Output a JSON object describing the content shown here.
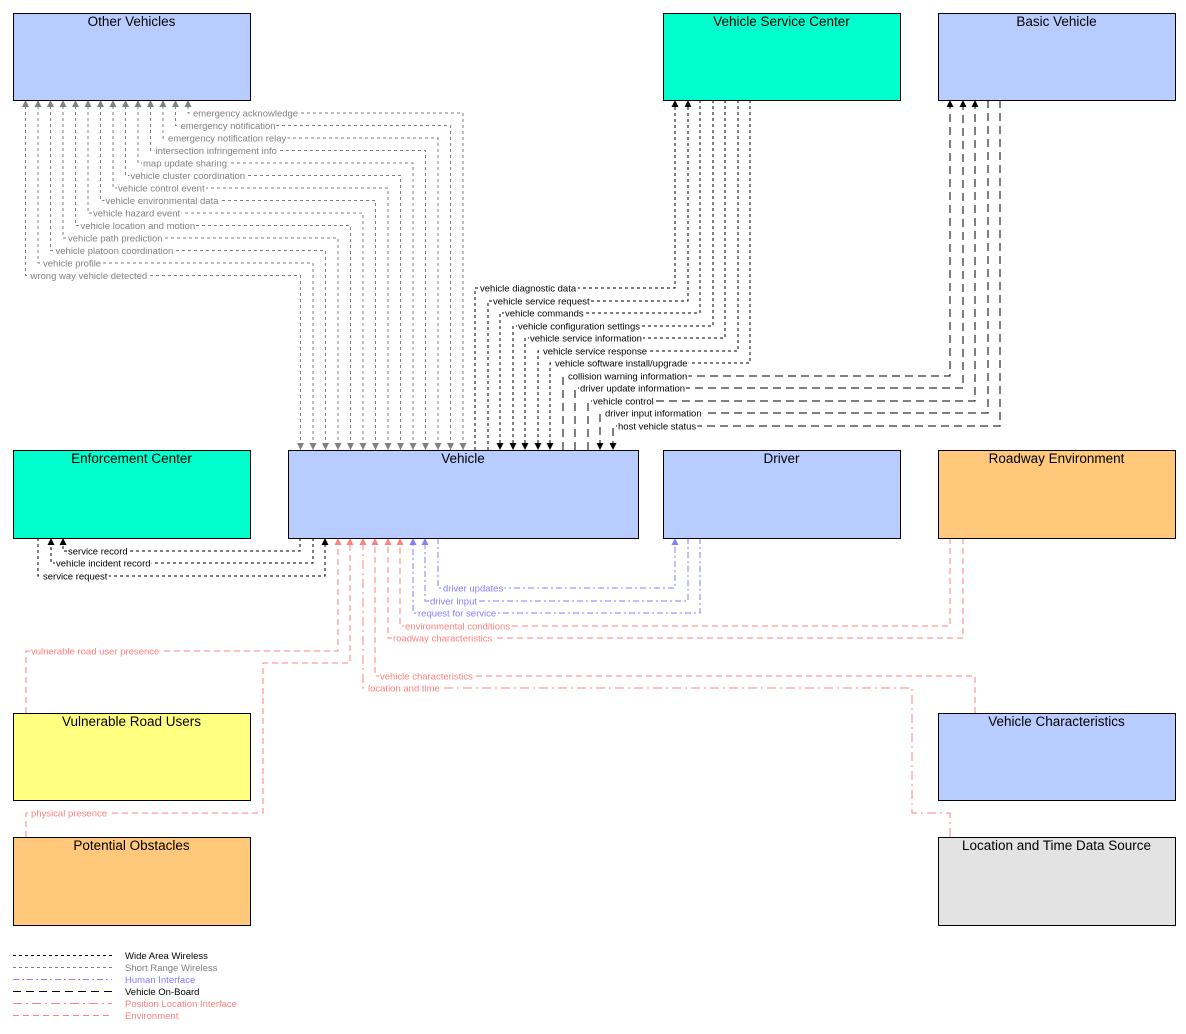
{
  "colors": {
    "wide_area_wireless": "#000000",
    "short_range_wireless": "#808080",
    "human_interface": "#8080ff",
    "vehicle_on_board": "#000000",
    "position_location_interface": "#ff8080",
    "environment": "#ff8080",
    "box_blue": "#b8ccff",
    "box_teal": "#00ffcc",
    "box_yellow": "#ffff80",
    "box_orange": "#ffc87a",
    "box_gray": "#e3e3e3"
  },
  "boxes": [
    {
      "id": "other-vehicles",
      "title": "Other Vehicles",
      "fill": "box_blue"
    },
    {
      "id": "vehicle-service-center",
      "title": "Vehicle Service Center",
      "fill": "box_teal"
    },
    {
      "id": "basic-vehicle",
      "title": "Basic Vehicle",
      "fill": "box_blue"
    },
    {
      "id": "enforcement-center",
      "title": "Enforcement Center",
      "fill": "box_teal"
    },
    {
      "id": "vehicle",
      "title": "Vehicle",
      "fill": "box_blue"
    },
    {
      "id": "driver",
      "title": "Driver",
      "fill": "box_blue"
    },
    {
      "id": "roadway-environment",
      "title": "Roadway Environment",
      "fill": "box_orange"
    },
    {
      "id": "vulnerable-road-users",
      "title": "Vulnerable Road Users",
      "fill": "box_yellow"
    },
    {
      "id": "vehicle-characteristics",
      "title": "Vehicle Characteristics",
      "fill": "box_blue"
    },
    {
      "id": "potential-obstacles",
      "title": "Potential Obstacles",
      "fill": "box_orange"
    },
    {
      "id": "location-and-time-data-source",
      "title": "Location and Time Data Source",
      "fill": "box_gray"
    }
  ],
  "flows": [
    {
      "label": "emergency acknowledge",
      "type": "short_range_wireless",
      "between": [
        "Other Vehicles",
        "Vehicle"
      ],
      "bidirectional": true
    },
    {
      "label": "emergency notification",
      "type": "short_range_wireless",
      "between": [
        "Other Vehicles",
        "Vehicle"
      ],
      "bidirectional": true
    },
    {
      "label": "emergency notification relay",
      "type": "short_range_wireless",
      "between": [
        "Other Vehicles",
        "Vehicle"
      ],
      "bidirectional": true
    },
    {
      "label": "intersection infringement info",
      "type": "short_range_wireless",
      "between": [
        "Other Vehicles",
        "Vehicle"
      ],
      "bidirectional": true
    },
    {
      "label": "map update sharing",
      "type": "short_range_wireless",
      "between": [
        "Other Vehicles",
        "Vehicle"
      ],
      "bidirectional": true
    },
    {
      "label": "vehicle cluster coordination",
      "type": "short_range_wireless",
      "between": [
        "Other Vehicles",
        "Vehicle"
      ],
      "bidirectional": true
    },
    {
      "label": "vehicle control event",
      "type": "short_range_wireless",
      "between": [
        "Other Vehicles",
        "Vehicle"
      ],
      "bidirectional": true
    },
    {
      "label": "vehicle environmental data",
      "type": "short_range_wireless",
      "between": [
        "Other Vehicles",
        "Vehicle"
      ],
      "bidirectional": true
    },
    {
      "label": "vehicle hazard event",
      "type": "short_range_wireless",
      "between": [
        "Other Vehicles",
        "Vehicle"
      ],
      "bidirectional": true
    },
    {
      "label": "vehicle location and motion",
      "type": "short_range_wireless",
      "between": [
        "Other Vehicles",
        "Vehicle"
      ],
      "bidirectional": true
    },
    {
      "label": "vehicle path prediction",
      "type": "short_range_wireless",
      "between": [
        "Other Vehicles",
        "Vehicle"
      ],
      "bidirectional": true
    },
    {
      "label": "vehicle platoon coordination",
      "type": "short_range_wireless",
      "between": [
        "Other Vehicles",
        "Vehicle"
      ],
      "bidirectional": true
    },
    {
      "label": "vehicle profile",
      "type": "short_range_wireless",
      "between": [
        "Other Vehicles",
        "Vehicle"
      ],
      "bidirectional": true
    },
    {
      "label": "wrong way vehicle detected",
      "type": "short_range_wireless",
      "between": [
        "Other Vehicles",
        "Vehicle"
      ],
      "bidirectional": true
    },
    {
      "label": "vehicle diagnostic data",
      "type": "wide_area_wireless",
      "from": "Vehicle",
      "to": "Vehicle Service Center"
    },
    {
      "label": "vehicle service request",
      "type": "wide_area_wireless",
      "from": "Vehicle",
      "to": "Vehicle Service Center"
    },
    {
      "label": "vehicle commands",
      "type": "wide_area_wireless",
      "from": "Vehicle Service Center",
      "to": "Vehicle"
    },
    {
      "label": "vehicle configuration settings",
      "type": "wide_area_wireless",
      "from": "Vehicle Service Center",
      "to": "Vehicle"
    },
    {
      "label": "vehicle service information",
      "type": "wide_area_wireless",
      "from": "Vehicle Service Center",
      "to": "Vehicle"
    },
    {
      "label": "vehicle service response",
      "type": "wide_area_wireless",
      "from": "Vehicle Service Center",
      "to": "Vehicle"
    },
    {
      "label": "vehicle software install/upgrade",
      "type": "wide_area_wireless",
      "from": "Vehicle Service Center",
      "to": "Vehicle"
    },
    {
      "label": "collision warning information",
      "type": "vehicle_on_board",
      "from": "Vehicle",
      "to": "Basic Vehicle"
    },
    {
      "label": "driver update information",
      "type": "vehicle_on_board",
      "from": "Vehicle",
      "to": "Basic Vehicle"
    },
    {
      "label": "vehicle control",
      "type": "vehicle_on_board",
      "from": "Vehicle",
      "to": "Basic Vehicle"
    },
    {
      "label": "driver input information",
      "type": "vehicle_on_board",
      "from": "Basic Vehicle",
      "to": "Vehicle"
    },
    {
      "label": "host vehicle status",
      "type": "vehicle_on_board",
      "from": "Basic Vehicle",
      "to": "Vehicle"
    },
    {
      "label": "service record",
      "type": "wide_area_wireless",
      "from": "Vehicle",
      "to": "Enforcement Center"
    },
    {
      "label": "vehicle incident record",
      "type": "wide_area_wireless",
      "from": "Vehicle",
      "to": "Enforcement Center"
    },
    {
      "label": "service request",
      "type": "wide_area_wireless",
      "from": "Enforcement Center",
      "to": "Vehicle"
    },
    {
      "label": "driver updates",
      "type": "human_interface",
      "from": "Vehicle",
      "to": "Driver"
    },
    {
      "label": "driver input",
      "type": "human_interface",
      "from": "Driver",
      "to": "Vehicle"
    },
    {
      "label": "request for service",
      "type": "human_interface",
      "from": "Driver",
      "to": "Vehicle"
    },
    {
      "label": "environmental conditions",
      "type": "environment",
      "from": "Roadway Environment",
      "to": "Vehicle"
    },
    {
      "label": "roadway characteristics",
      "type": "environment",
      "from": "Roadway Environment",
      "to": "Vehicle"
    },
    {
      "label": "vulnerable road user presence",
      "type": "environment",
      "from": "Vulnerable Road Users",
      "to": "Vehicle"
    },
    {
      "label": "physical presence",
      "type": "environment",
      "from": "Potential Obstacles",
      "to": "Vehicle"
    },
    {
      "label": "vehicle characteristics",
      "type": "environment",
      "from": "Vehicle Characteristics",
      "to": "Vehicle"
    },
    {
      "label": "location and time",
      "type": "position_location_interface",
      "from": "Location and Time Data Source",
      "to": "Vehicle"
    }
  ],
  "legend": [
    {
      "type": "wide_area_wireless",
      "label": "Wide Area Wireless"
    },
    {
      "type": "short_range_wireless",
      "label": "Short Range Wireless"
    },
    {
      "type": "human_interface",
      "label": "Human Interface"
    },
    {
      "type": "vehicle_on_board",
      "label": "Vehicle On-Board"
    },
    {
      "type": "position_location_interface",
      "label": "Position Location Interface"
    },
    {
      "type": "environment",
      "label": "Environment"
    }
  ]
}
